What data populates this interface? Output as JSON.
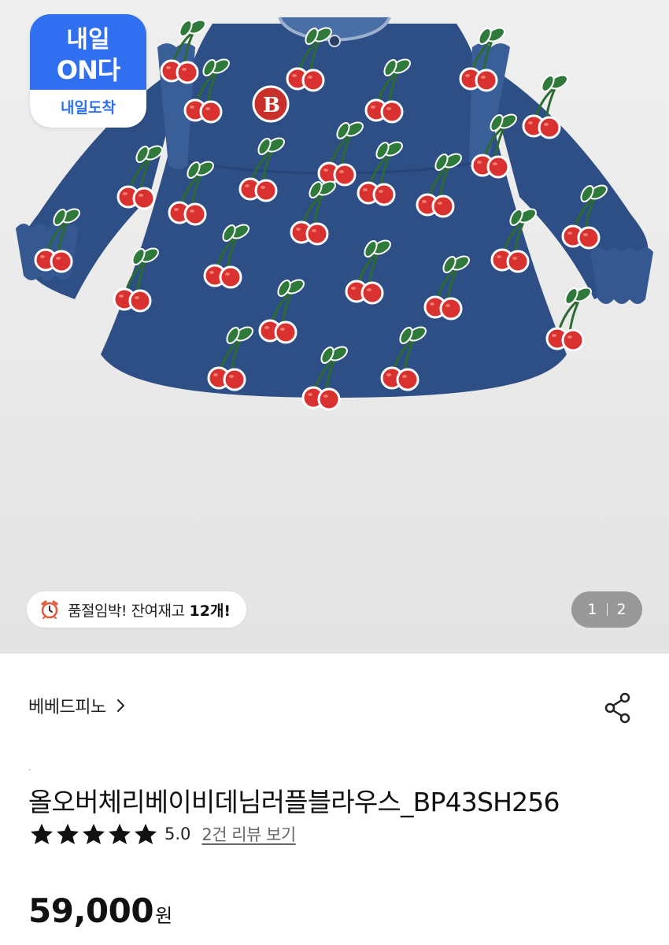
{
  "badge": {
    "line1": "내일",
    "line2": "ON다",
    "footer": "내일도착",
    "color": "#2f6ff0"
  },
  "image_pager": {
    "current": "1",
    "total": "2"
  },
  "stock_notice": {
    "icon": "alarm-clock-icon",
    "text": "품절임박! 잔여재고",
    "count": "12개!"
  },
  "product": {
    "brand": "베베드피노",
    "dot": ".",
    "title": "올오버체리베이비데님러플블라우스_BP43SH256",
    "rating": {
      "stars": 5,
      "score": "5.0",
      "reviews_link": "2건 리뷰 보기"
    },
    "price": "59,000",
    "currency": "원"
  },
  "colors": {
    "denim": "#2e4f86",
    "cherry": "#d9312f",
    "leaf": "#2f7a3a"
  }
}
